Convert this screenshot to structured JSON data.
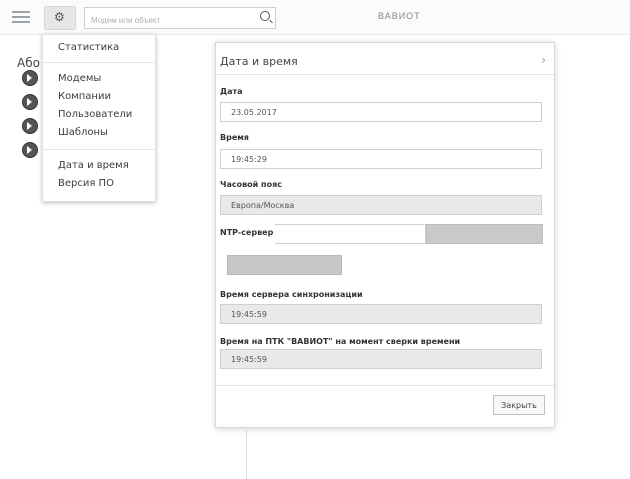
{
  "topbar": {
    "search_placeholder": "Модем или объект",
    "logo": "ВАВИОТ"
  },
  "background": {
    "heading": "Або"
  },
  "menu": {
    "items": [
      "Статистика",
      "Модемы",
      "Компании",
      "Пользователи",
      "Шаблоны",
      "Дата и время",
      "Версия ПО"
    ]
  },
  "dialog": {
    "title": "Дата и время",
    "close_symbol": "›",
    "fields": {
      "date_label": "Дата",
      "date_value": "23.05.2017",
      "time_label": "Время",
      "time_value": "19:45:29",
      "timezone_label": "Часовой пояс",
      "timezone_value": "Европа/Москва",
      "ntp_label": "NTP-сервер",
      "ntp_value": "",
      "sync_time_label": "Время сервера синхронизации",
      "sync_time_value": "19:45:59",
      "ptk_time_label": "Время на ПТК \"ВАВИОТ\" на момент сверки времени",
      "ptk_time_value": "19:45:59"
    },
    "close_button": "Закрыть"
  }
}
